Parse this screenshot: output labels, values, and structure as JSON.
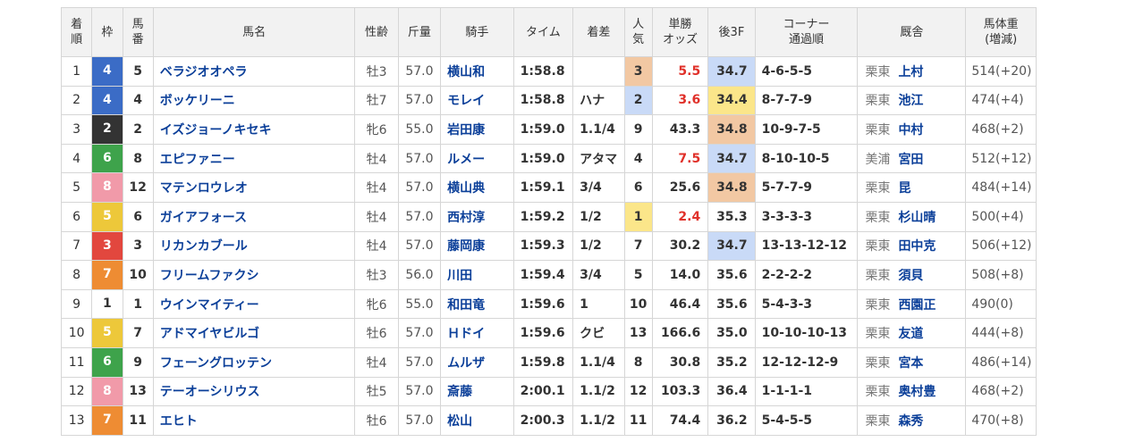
{
  "colors": {
    "waku": {
      "1": "#ffffff",
      "2": "#333333",
      "3": "#e2473e",
      "4": "#3b6cc6",
      "5": "#edc83a",
      "6": "#3ea34b",
      "7": "#ee8c33",
      "8": "#f19aa9"
    },
    "waku_text": {
      "1": "#333333",
      "2": "#ffffff",
      "3": "#ffffff",
      "4": "#ffffff",
      "5": "#ffffff",
      "6": "#ffffff",
      "7": "#ffffff",
      "8": "#ffffff"
    },
    "pop_highlight": {
      "1": "#fbe68a",
      "2": "#c9daf7",
      "3": "#f2c8a3"
    },
    "odds_highlight": "#e0312a",
    "last3f_highlight": {
      "1": "#fbe68a",
      "2": "#f2c8a3",
      "3": "#c9daf7"
    }
  },
  "headers": {
    "rank": [
      "着",
      "順"
    ],
    "waku": "枠",
    "umaban": [
      "馬",
      "番"
    ],
    "name": "馬名",
    "sexage": "性齢",
    "weight": "斤量",
    "jockey": "騎手",
    "time": "タイム",
    "margin": "着差",
    "pop": [
      "人",
      "気"
    ],
    "odds": [
      "単勝",
      "オッズ"
    ],
    "last3f": "後3F",
    "corner": [
      "コーナー",
      "通過順"
    ],
    "trainer": "厩舎",
    "bw": [
      "馬体重",
      "(増減)"
    ]
  },
  "rows": [
    {
      "rank": "1",
      "waku": "4",
      "umaban": "5",
      "name": "ベラジオオペラ",
      "sexage": "牡3",
      "weight": "57.0",
      "jockey": "横山和",
      "time": "1:58.8",
      "margin": "",
      "pop": "3",
      "odds": "5.5",
      "last3f": "34.7",
      "corner": "4-6-5-5",
      "tc": "栗東",
      "trainer": "上村",
      "bw": "514(+20)",
      "pop_hl": "3",
      "odds_red": true,
      "l3f_hl": "3"
    },
    {
      "rank": "2",
      "waku": "4",
      "umaban": "4",
      "name": "ボッケリーニ",
      "sexage": "牡7",
      "weight": "57.0",
      "jockey": "モレイ",
      "time": "1:58.8",
      "margin": "ハナ",
      "pop": "2",
      "odds": "3.6",
      "last3f": "34.4",
      "corner": "8-7-7-9",
      "tc": "栗東",
      "trainer": "池江",
      "bw": "474(+4)",
      "pop_hl": "2",
      "odds_red": true,
      "l3f_hl": "1"
    },
    {
      "rank": "3",
      "waku": "2",
      "umaban": "2",
      "name": "イズジョーノキセキ",
      "sexage": "牝6",
      "weight": "55.0",
      "jockey": "岩田康",
      "time": "1:59.0",
      "margin": "1.1/4",
      "pop": "9",
      "odds": "43.3",
      "last3f": "34.8",
      "corner": "10-9-7-5",
      "tc": "栗東",
      "trainer": "中村",
      "bw": "468(+2)",
      "pop_hl": "",
      "odds_red": false,
      "l3f_hl": "2"
    },
    {
      "rank": "4",
      "waku": "6",
      "umaban": "8",
      "name": "エピファニー",
      "sexage": "牡4",
      "weight": "57.0",
      "jockey": "ルメー",
      "time": "1:59.0",
      "margin": "アタマ",
      "pop": "4",
      "odds": "7.5",
      "last3f": "34.7",
      "corner": "8-10-10-5",
      "tc": "美浦",
      "trainer": "宮田",
      "bw": "512(+12)",
      "pop_hl": "",
      "odds_red": true,
      "l3f_hl": "3"
    },
    {
      "rank": "5",
      "waku": "8",
      "umaban": "12",
      "name": "マテンロウレオ",
      "sexage": "牡4",
      "weight": "57.0",
      "jockey": "横山典",
      "time": "1:59.1",
      "margin": "3/4",
      "pop": "6",
      "odds": "25.6",
      "last3f": "34.8",
      "corner": "5-7-7-9",
      "tc": "栗東",
      "trainer": "昆",
      "bw": "484(+14)",
      "pop_hl": "",
      "odds_red": false,
      "l3f_hl": "2"
    },
    {
      "rank": "6",
      "waku": "5",
      "umaban": "6",
      "name": "ガイアフォース",
      "sexage": "牡4",
      "weight": "57.0",
      "jockey": "西村淳",
      "time": "1:59.2",
      "margin": "1/2",
      "pop": "1",
      "odds": "2.4",
      "last3f": "35.3",
      "corner": "3-3-3-3",
      "tc": "栗東",
      "trainer": "杉山晴",
      "bw": "500(+4)",
      "pop_hl": "1",
      "odds_red": true,
      "l3f_hl": ""
    },
    {
      "rank": "7",
      "waku": "3",
      "umaban": "3",
      "name": "リカンカブール",
      "sexage": "牡4",
      "weight": "57.0",
      "jockey": "藤岡康",
      "time": "1:59.3",
      "margin": "1/2",
      "pop": "7",
      "odds": "30.2",
      "last3f": "34.7",
      "corner": "13-13-12-12",
      "tc": "栗東",
      "trainer": "田中克",
      "bw": "506(+12)",
      "pop_hl": "",
      "odds_red": false,
      "l3f_hl": "3"
    },
    {
      "rank": "8",
      "waku": "7",
      "umaban": "10",
      "name": "フリームファクシ",
      "sexage": "牡3",
      "weight": "56.0",
      "jockey": "川田",
      "time": "1:59.4",
      "margin": "3/4",
      "pop": "5",
      "odds": "14.0",
      "last3f": "35.6",
      "corner": "2-2-2-2",
      "tc": "栗東",
      "trainer": "須貝",
      "bw": "508(+8)",
      "pop_hl": "",
      "odds_red": false,
      "l3f_hl": ""
    },
    {
      "rank": "9",
      "waku": "1",
      "umaban": "1",
      "name": "ウインマイティー",
      "sexage": "牝6",
      "weight": "55.0",
      "jockey": "和田竜",
      "time": "1:59.6",
      "margin": "1",
      "pop": "10",
      "odds": "46.4",
      "last3f": "35.6",
      "corner": "5-4-3-3",
      "tc": "栗東",
      "trainer": "西園正",
      "bw": "490(0)",
      "pop_hl": "",
      "odds_red": false,
      "l3f_hl": ""
    },
    {
      "rank": "10",
      "waku": "5",
      "umaban": "7",
      "name": "アドマイヤビルゴ",
      "sexage": "牡6",
      "weight": "57.0",
      "jockey": "Ｈドイ",
      "time": "1:59.6",
      "margin": "クビ",
      "pop": "13",
      "odds": "166.6",
      "last3f": "35.0",
      "corner": "10-10-10-13",
      "tc": "栗東",
      "trainer": "友道",
      "bw": "444(+8)",
      "pop_hl": "",
      "odds_red": false,
      "l3f_hl": ""
    },
    {
      "rank": "11",
      "waku": "6",
      "umaban": "9",
      "name": "フェーングロッテン",
      "sexage": "牡4",
      "weight": "57.0",
      "jockey": "ムルザ",
      "time": "1:59.8",
      "margin": "1.1/4",
      "pop": "8",
      "odds": "30.8",
      "last3f": "35.2",
      "corner": "12-12-12-9",
      "tc": "栗東",
      "trainer": "宮本",
      "bw": "486(+14)",
      "pop_hl": "",
      "odds_red": false,
      "l3f_hl": ""
    },
    {
      "rank": "12",
      "waku": "8",
      "umaban": "13",
      "name": "テーオーシリウス",
      "sexage": "牡5",
      "weight": "57.0",
      "jockey": "斎藤",
      "time": "2:00.1",
      "margin": "1.1/2",
      "pop": "12",
      "odds": "103.3",
      "last3f": "36.4",
      "corner": "1-1-1-1",
      "tc": "栗東",
      "trainer": "奥村豊",
      "bw": "468(+2)",
      "pop_hl": "",
      "odds_red": false,
      "l3f_hl": ""
    },
    {
      "rank": "13",
      "waku": "7",
      "umaban": "11",
      "name": "エヒト",
      "sexage": "牡6",
      "weight": "57.0",
      "jockey": "松山",
      "time": "2:00.3",
      "margin": "1.1/2",
      "pop": "11",
      "odds": "74.4",
      "last3f": "36.2",
      "corner": "5-4-5-5",
      "tc": "栗東",
      "trainer": "森秀",
      "bw": "470(+8)",
      "pop_hl": "",
      "odds_red": false,
      "l3f_hl": ""
    }
  ]
}
